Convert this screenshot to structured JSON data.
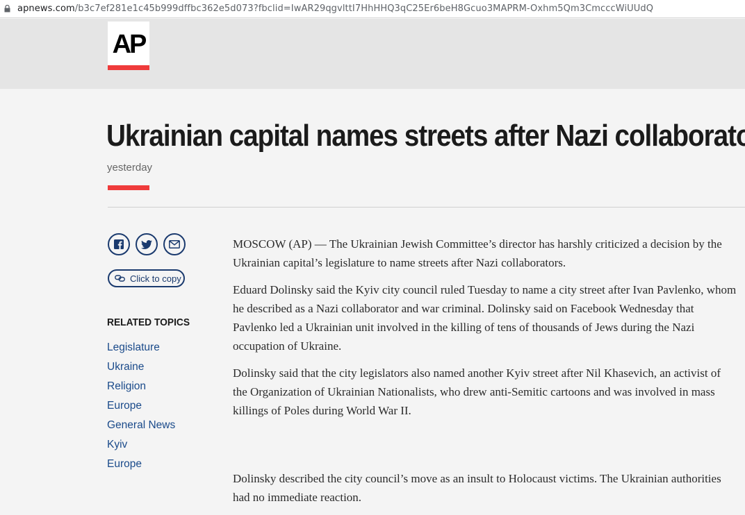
{
  "browser": {
    "url_host": "apnews.com",
    "url_path": "/b3c7ef281e1c45b999dffbc362e5d073?fbclid=IwAR29qgvlttI7HhHHQ3qC25Er6beH8Gcuo3MAPRM-Oxhm5Qm3CmcccWiUUdQ"
  },
  "header": {
    "logo_text": "AP",
    "brand_color": "#ef3b3b"
  },
  "article": {
    "headline": "Ukrainian capital names streets after Nazi collaborators",
    "timestamp": "yesterday",
    "paragraphs": [
      "MOSCOW (AP) — The Ukrainian Jewish Committee’s director has harshly criticized a decision by the Ukrainian capital’s legislature to name streets after Nazi collaborators.",
      "Eduard Dolinsky said the Kyiv city council ruled Tuesday to name a city street after Ivan Pavlenko, whom he described as a Nazi collaborator and war criminal. Dolinsky said on Facebook Wednesday that Pavlenko led a Ukrainian unit involved in the killing of tens of thousands of Jews during the Nazi occupation of Ukraine.",
      "Dolinsky said that the city legislators also named another Kyiv street after Nil Khasevich, an activist of the Organization of Ukrainian Nationalists, who drew anti-Semitic cartoons and was involved in mass killings of Poles during World War II.",
      "Dolinsky described the city council’s move as an insult to Holocaust victims. The Ukrainian authorities had no immediate reaction."
    ]
  },
  "share": {
    "icons": [
      "facebook-icon",
      "twitter-icon",
      "email-icon"
    ],
    "copy_label": "Click to copy"
  },
  "related": {
    "heading": "RELATED TOPICS",
    "topics": [
      "Legislature",
      "Ukraine",
      "Religion",
      "Europe",
      "General News",
      "Kyiv",
      "Europe"
    ]
  }
}
